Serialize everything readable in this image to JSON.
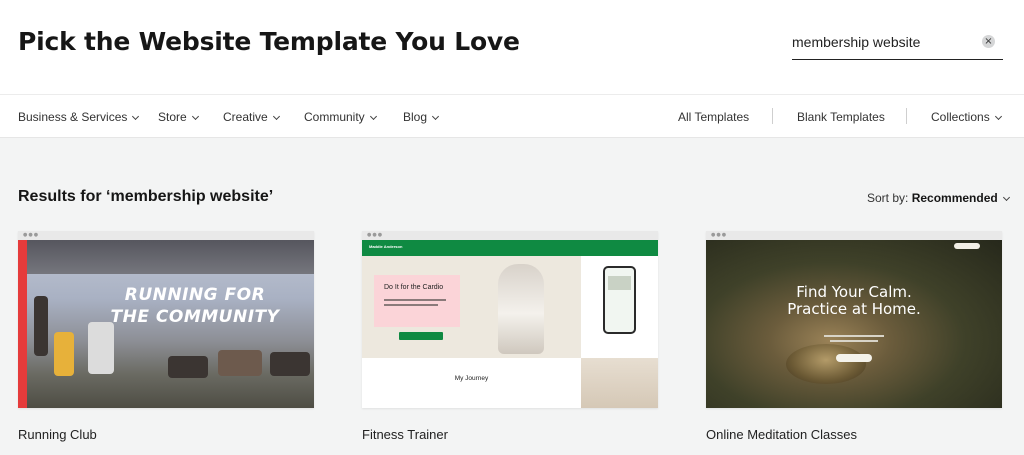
{
  "header": {
    "title": "Pick the Website Template You Love",
    "search_value": "membership website",
    "clear_icon": "×"
  },
  "nav": {
    "categories": [
      {
        "label": "Business & Services"
      },
      {
        "label": "Store"
      },
      {
        "label": "Creative"
      },
      {
        "label": "Community"
      },
      {
        "label": "Blog"
      }
    ],
    "links": [
      {
        "label": "All Templates"
      },
      {
        "label": "Blank Templates"
      },
      {
        "label": "Collections"
      }
    ]
  },
  "results": {
    "title": "Results for ‘membership website’",
    "sort_label": "Sort by:",
    "sort_value": "Recommended"
  },
  "templates": [
    {
      "name": "Running Club",
      "preview_text": [
        "RUNNING FOR",
        "THE COMMUNITY"
      ]
    },
    {
      "name": "Fitness Trainer",
      "preview_brand": "Maddie Anderson",
      "preview_headline": "Do It for the Cardio",
      "preview_section": "My Journey"
    },
    {
      "name": "Online Meditation Classes",
      "preview_headline": [
        "Find Your Calm.",
        "Practice at Home."
      ]
    }
  ],
  "colors": {
    "accent_green": "#0f8a42",
    "accent_red": "#e53b3b",
    "background": "#f3f4f4"
  }
}
